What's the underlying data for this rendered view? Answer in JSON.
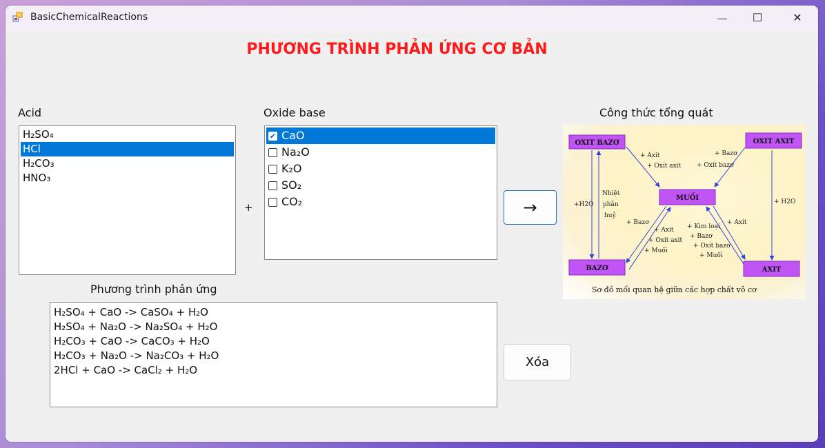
{
  "window": {
    "title": "BasicChemicalReactions"
  },
  "titlebar_buttons": {
    "minimize": "—",
    "maximize": "☐",
    "close": "✕"
  },
  "heading": "PHƯƠNG TRÌNH PHẢN ỨNG CƠ BẢN",
  "acid": {
    "label": "Acid",
    "items": [
      "H₂SO₄",
      "HCl",
      "H₂CO₃",
      "HNO₃"
    ],
    "selected": "HCl"
  },
  "plus": "+",
  "oxide_base": {
    "label": "Oxide base",
    "items": [
      {
        "label": "CaO",
        "checked": true
      },
      {
        "label": "Na₂O",
        "checked": false
      },
      {
        "label": "K₂O",
        "checked": false
      },
      {
        "label": "SO₂",
        "checked": false
      },
      {
        "label": "CO₂",
        "checked": false
      }
    ],
    "selected": "CaO"
  },
  "arrow_button": "→",
  "clear_button": "Xóa",
  "general_formula": {
    "label": "Công thức tổng quát",
    "diagram": {
      "nodes": {
        "oxit_bazo": "OXIT BAZƠ",
        "oxit_axit": "OXIT AXIT",
        "muoi": "MUỐI",
        "bazo": "BAZƠ",
        "axit": "AXIT"
      },
      "labels": {
        "ob_to_muoi_1": "+ Axit",
        "ob_to_muoi_2": "+ Oxit axit",
        "oa_to_muoi_1": "+ Bazơ",
        "oa_to_muoi_2": "+ Oxit bazơ",
        "h2o_left": "+H2O",
        "nhiet_1": "Nhiệt",
        "nhiet_2": "phân",
        "nhiet_3": "huỷ",
        "h2o_right": "+ H2O",
        "bazo_to_muoi": "+ Bazơ",
        "bz_1": "+ Axit",
        "bz_2": "+ Oxit axit",
        "bz_3": "+ Muối",
        "ax_1": "+ Kim loại",
        "ax_2": "+ Bazơ",
        "ax_3": "+ Oxit bazơ",
        "ax_4": "+ Muối",
        "axit_label": "+ Axit"
      },
      "caption": "Sơ đồ mối quan hệ giữa các hợp chất vô cơ"
    }
  },
  "equations": {
    "label": "Phương trình phản ứng",
    "lines": [
      "H₂SO₄ + CaO -> CaSO₄ + H₂O",
      "H₂SO₄ + Na₂O -> Na₂SO₄ + H₂O",
      "H₂CO₃ + CaO -> CaCO₃ + H₂O",
      "H₂CO₃ + Na₂O -> Na₂CO₃ + H₂O",
      "2HCl + CaO -> CaCl₂ + H₂O"
    ]
  },
  "colors": {
    "heading": "#ff1a1a",
    "selection": "#0078d7",
    "diagram_node": "#c154f5"
  }
}
